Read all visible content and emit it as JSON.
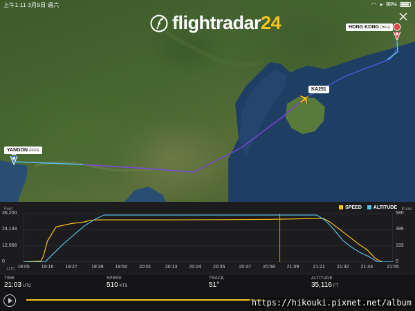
{
  "status_bar": {
    "time": "上午1:11",
    "date": "3月9日 週六",
    "battery": "98%"
  },
  "logo": {
    "text": "flightradar",
    "number": "24"
  },
  "map": {
    "origin": {
      "name": "YANGON",
      "code": "(RGN)"
    },
    "destination": {
      "name": "HONG KONG",
      "code": "(HKG)"
    },
    "flight": "KA251"
  },
  "chart_data": {
    "type": "line",
    "title": "",
    "legend": [
      "SPEED",
      "ALTITUDE"
    ],
    "legend_position": "top-right",
    "y_left": {
      "unit": "Feet",
      "ticks": [
        "36,200",
        "24,133",
        "12,066",
        "0"
      ],
      "range": [
        0,
        36200
      ]
    },
    "y_right": {
      "unit": "Knots",
      "ticks": [
        "580",
        "386",
        "193",
        "0"
      ],
      "range": [
        0,
        580
      ]
    },
    "x": {
      "unit": "UTC",
      "ticks": [
        "19:05",
        "19:16",
        "19:27",
        "19:39",
        "19:50",
        "20:01",
        "20:13",
        "20:24",
        "20:35",
        "20:47",
        "20:58",
        "21:09",
        "21:21",
        "21:32",
        "21:43",
        "21:55"
      ]
    },
    "cursor_time": "21:03",
    "series": [
      {
        "name": "SPEED",
        "color": "#f7c31d",
        "points": [
          [
            "19:05",
            0
          ],
          [
            "19:13",
            10
          ],
          [
            "19:14",
            60
          ],
          [
            "19:16",
            250
          ],
          [
            "19:20",
            420
          ],
          [
            "19:27",
            460
          ],
          [
            "19:33",
            480
          ],
          [
            "19:36",
            500
          ],
          [
            "19:39",
            505
          ],
          [
            "19:50",
            505
          ],
          [
            "20:13",
            505
          ],
          [
            "20:35",
            507
          ],
          [
            "20:58",
            510
          ],
          [
            "21:09",
            515
          ],
          [
            "21:18",
            520
          ],
          [
            "21:23",
            520
          ],
          [
            "21:26",
            480
          ],
          [
            "21:30",
            400
          ],
          [
            "21:35",
            300
          ],
          [
            "21:40",
            200
          ],
          [
            "21:43",
            150
          ],
          [
            "21:47",
            40
          ],
          [
            "21:50",
            0
          ]
        ]
      },
      {
        "name": "ALTITUDE",
        "color": "#5bc0ea",
        "points": [
          [
            "19:05",
            0
          ],
          [
            "19:15",
            0
          ],
          [
            "19:18",
            5000
          ],
          [
            "19:23",
            13000
          ],
          [
            "19:28",
            20000
          ],
          [
            "19:33",
            27000
          ],
          [
            "19:38",
            32000
          ],
          [
            "19:42",
            35116
          ],
          [
            "20:13",
            35116
          ],
          [
            "20:47",
            35116
          ],
          [
            "21:09",
            35116
          ],
          [
            "21:20",
            35116
          ],
          [
            "21:24",
            31000
          ],
          [
            "21:28",
            24000
          ],
          [
            "21:32",
            16000
          ],
          [
            "21:36",
            11000
          ],
          [
            "21:40",
            7000
          ],
          [
            "21:44",
            4000
          ],
          [
            "21:48",
            0
          ],
          [
            "21:55",
            0
          ]
        ]
      }
    ]
  },
  "stats": [
    {
      "label": "TIME",
      "value": "21:03",
      "unit": "UTC"
    },
    {
      "label": "SPEED",
      "value": "510",
      "unit": "KTS"
    },
    {
      "label": "TRACK",
      "value": "51°",
      "unit": ""
    },
    {
      "label": "ALTITUDE",
      "value": "35,116",
      "unit": "FT"
    }
  ],
  "playback": {
    "progress": 0.62
  },
  "watermark": "https://hikouki.pixnet.net/album"
}
